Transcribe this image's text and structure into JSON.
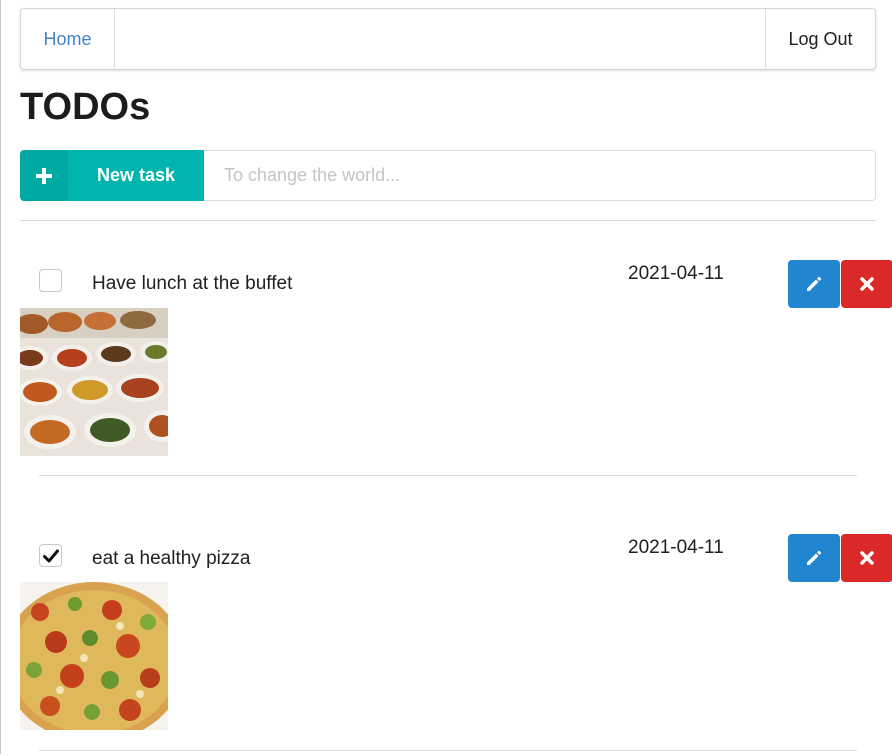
{
  "nav": {
    "home_label": "Home",
    "logout_label": "Log Out"
  },
  "page": {
    "title": "TODOs"
  },
  "new_task": {
    "button_label": "New task",
    "input_placeholder": "To change the world...",
    "input_value": ""
  },
  "todos": [
    {
      "text": "Have lunch at the buffet",
      "date": "2021-04-11",
      "completed": false,
      "image": "buffet-food-photo"
    },
    {
      "text": "eat a healthy pizza",
      "date": "2021-04-11",
      "completed": true,
      "image": "pizza-photo"
    }
  ],
  "colors": {
    "accent_teal": "#00b5ad",
    "edit_blue": "#2185d0",
    "delete_red": "#db2828",
    "link_blue": "#4183c4"
  },
  "icons": {
    "new_task": "plus-icon",
    "edit": "pencil-icon",
    "delete": "close-icon",
    "checked": "checkmark-icon"
  }
}
